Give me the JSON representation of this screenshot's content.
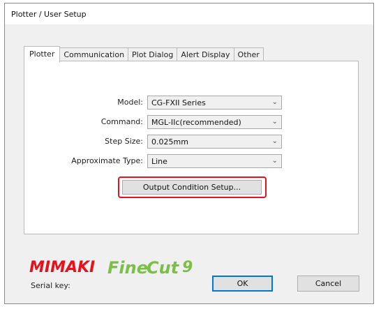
{
  "window": {
    "title": "Plotter / User Setup"
  },
  "tabs": [
    {
      "label": "Plotter",
      "active": true
    },
    {
      "label": "Communication",
      "active": false
    },
    {
      "label": "Plot Dialog",
      "active": false
    },
    {
      "label": "Alert Display",
      "active": false
    },
    {
      "label": "Other",
      "active": false
    }
  ],
  "fields": {
    "model": {
      "label": "Model:",
      "value": "CG-FXII Series"
    },
    "command": {
      "label": "Command:",
      "value": "MGL-IIc(recommended)"
    },
    "step_size": {
      "label": "Step Size:",
      "value": "0.025mm"
    },
    "approximate_type": {
      "label": "Approximate Type:",
      "value": "Line"
    }
  },
  "output_condition_button": "Output Condition Setup...",
  "logo": {
    "brand": "MIMAKI",
    "product_a": "Fine",
    "product_b": "Cut",
    "version": "9",
    "brand_color": "#e8101b",
    "product_color": "#7ac143"
  },
  "serial_label": "Serial key:",
  "buttons": {
    "ok": "OK",
    "cancel": "Cancel"
  },
  "colors": {
    "highlight": "#e8101b",
    "default_button_border": "#0078d7"
  }
}
